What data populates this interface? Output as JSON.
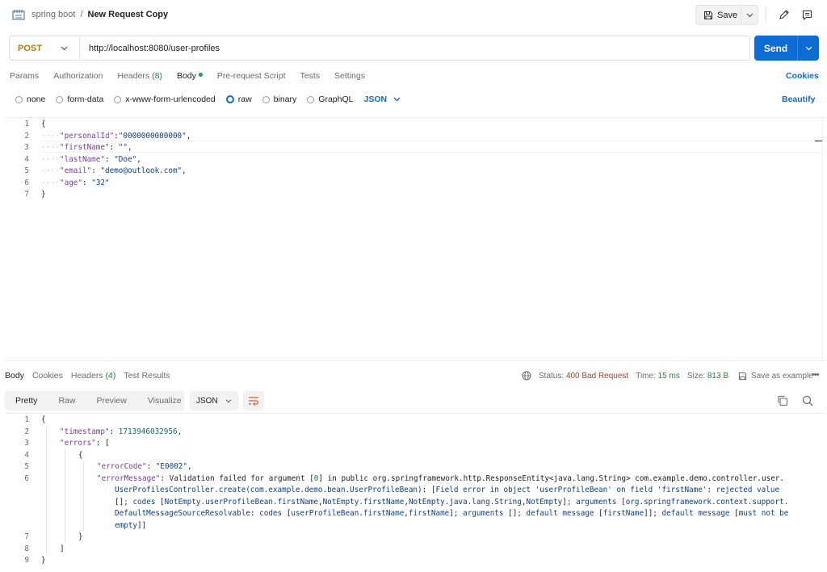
{
  "header": {
    "collection": "spring boot",
    "separator": "/",
    "request_name": "New Request Copy",
    "save_label": "Save"
  },
  "request": {
    "method": "POST",
    "url": "http://localhost:8080/user-profiles",
    "send_label": "Send"
  },
  "request_tabs": {
    "params": "Params",
    "authorization": "Authorization",
    "headers": "Headers",
    "headers_count": "(8)",
    "body": "Body",
    "pre_request": "Pre-request Script",
    "tests": "Tests",
    "settings": "Settings",
    "cookies": "Cookies"
  },
  "body_types": {
    "none": "none",
    "form_data": "form-data",
    "urlencoded": "x-www-form-urlencoded",
    "raw": "raw",
    "binary": "binary",
    "graphql": "GraphQL",
    "format": "JSON",
    "beautify": "Beautify"
  },
  "request_body_lines": [
    {
      "n": "1",
      "t": "{"
    },
    {
      "n": "2",
      "t": "\"personalId\":\"0000000000000\","
    },
    {
      "n": "3",
      "t": "\"firstName\": \"\","
    },
    {
      "n": "4",
      "t": "\"lastName\": \"Doe\","
    },
    {
      "n": "5",
      "t": "\"email\": \"demo@outlook.com\","
    },
    {
      "n": "6",
      "t": "\"age\": \"32\""
    },
    {
      "n": "7",
      "t": "}"
    }
  ],
  "response_tabs": {
    "body": "Body",
    "cookies": "Cookies",
    "headers": "Headers",
    "headers_count": "(4)",
    "test_results": "Test Results"
  },
  "response_status": {
    "status_label": "Status:",
    "status_value": "400 Bad Request",
    "time_label": "Time:",
    "time_value": "15 ms",
    "size_label": "Size:",
    "size_value": "813 B",
    "save_example": "Save as example"
  },
  "response_view": {
    "pretty": "Pretty",
    "raw": "Raw",
    "preview": "Preview",
    "visualize": "Visualize",
    "format": "JSON"
  },
  "response_body_lines": [
    {
      "n": "1",
      "t": "{"
    },
    {
      "n": "2",
      "t": "\"timestamp\": 1713946032956,"
    },
    {
      "n": "3",
      "t": "\"errors\": ["
    },
    {
      "n": "4",
      "t": "{"
    },
    {
      "n": "5",
      "t": "\"errorCode\": \"E0002\","
    },
    {
      "n": "6",
      "t": "\"errorMessage\": \"Validation failed for argument [0] in public org.springframework.http.ResponseEntity<java.lang.String> com.example.demo.controller.user."
    },
    {
      "n": "",
      "t": "UserProfilesController.create(com.example.demo.bean.UserProfileBean): [Field error in object 'userProfileBean' on field 'firstName': rejected value"
    },
    {
      "n": "",
      "t": "[]; codes [NotEmpty.userProfileBean.firstName,NotEmpty.firstName,NotEmpty.java.lang.String,NotEmpty]; arguments [org.springframework.context.support."
    },
    {
      "n": "",
      "t": "DefaultMessageSourceResolvable: codes [userProfileBean.firstName,firstName]; arguments []; default message [firstName]]; default message [must not be"
    },
    {
      "n": "",
      "t": "empty]] \""
    },
    {
      "n": "7",
      "t": "}"
    },
    {
      "n": "8",
      "t": "]"
    },
    {
      "n": "9",
      "t": "}"
    }
  ],
  "colors": {
    "accent": "#0c6cd4",
    "method_post": "#b7790f",
    "status_error": "#b83a32",
    "success": "#1a8a3a"
  }
}
